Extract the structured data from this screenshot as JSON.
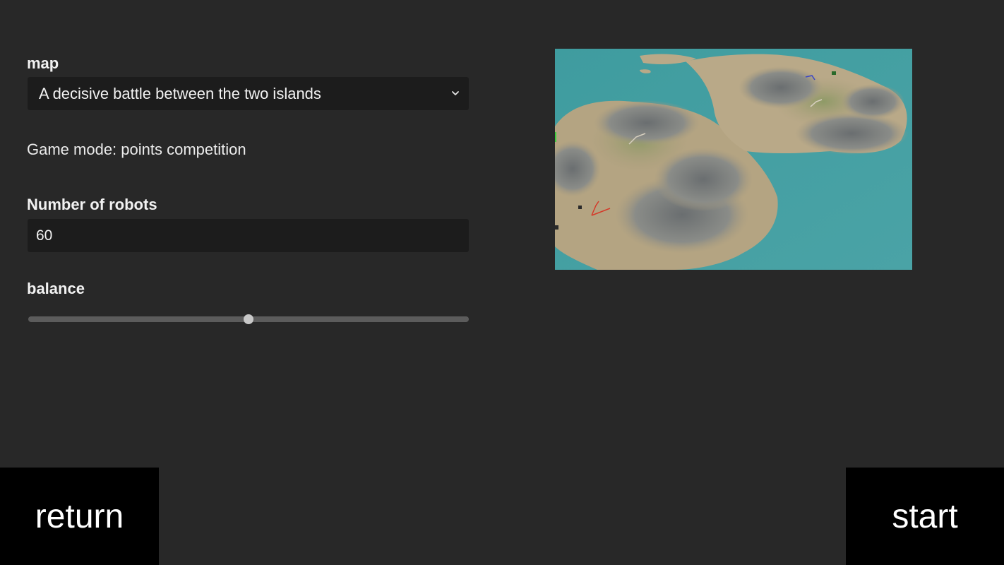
{
  "map": {
    "label": "map",
    "selected": "A decisive battle between the two islands",
    "icon": "chevron-down-icon"
  },
  "game_mode": {
    "text": "Game mode: points competition"
  },
  "robots": {
    "label": "Number of robots",
    "value": "60"
  },
  "balance": {
    "label": "balance",
    "fraction": 0.5
  },
  "buttons": {
    "return_label": "return",
    "start_label": "start"
  },
  "colors": {
    "background": "#282828",
    "field": "#1c1c1c",
    "button": "#000000"
  }
}
